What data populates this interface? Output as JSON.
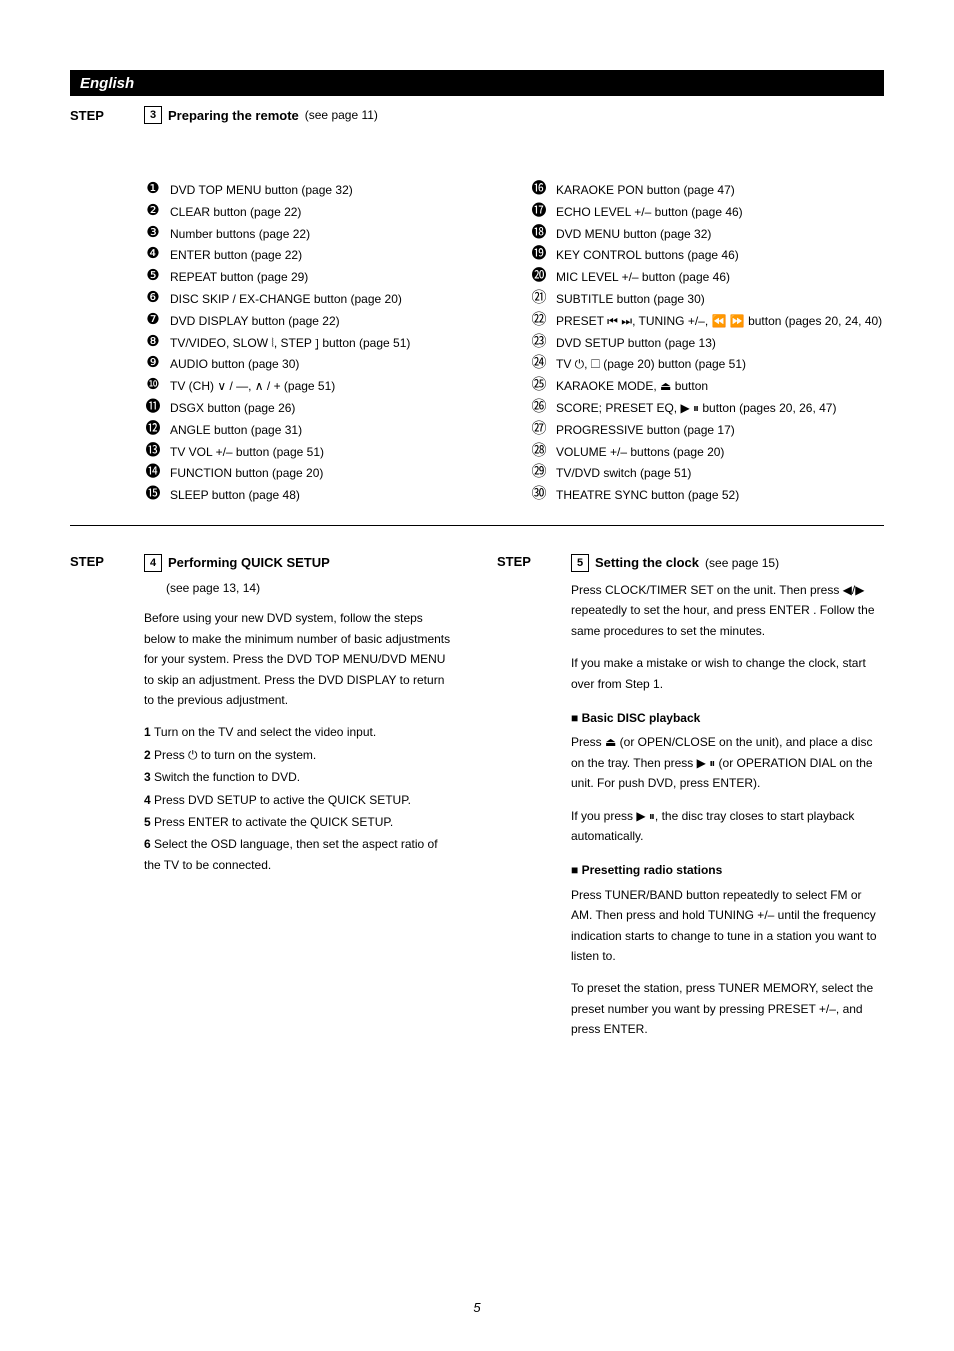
{
  "header_bar": "English",
  "step3": {
    "label": "STEP",
    "number": "3",
    "title": "Preparing the remote",
    "note": "(see page 11)",
    "columns": {
      "left": [
        {
          "num": "❶",
          "text": "DVD TOP MENU button (page 32)"
        },
        {
          "num": "❷",
          "text": "CLEAR button (page 22)"
        },
        {
          "num": "❸",
          "text": "Number buttons (page 22)"
        },
        {
          "num": "❹",
          "text": "ENTER button (page 22)"
        },
        {
          "num": "❺",
          "text": "REPEAT button (page 29)"
        },
        {
          "num": "❻",
          "text": "DISC SKIP / EX-CHANGE button (page 20)"
        },
        {
          "num": "❼",
          "text": "DVD DISPLAY button (page 22)"
        },
        {
          "num": "❽",
          "text": "TV/VIDEO, SLOW ⦚, STEP ⦌ button (page 51)"
        },
        {
          "num": "❾",
          "text": "AUDIO button (page 30)"
        },
        {
          "num": "❿",
          "text": "TV (CH) ∨ / —, ∧ / + (page 51)"
        },
        {
          "num": "⓫",
          "text": "DSGX button (page 26)"
        },
        {
          "num": "⓬",
          "text": "ANGLE button (page 31)"
        },
        {
          "num": "⓭",
          "text": "TV VOL +/– button (page 51)"
        },
        {
          "num": "⓮",
          "text": "FUNCTION button (page 20)"
        },
        {
          "num": "⓯",
          "text": "SLEEP button (page 48)"
        }
      ],
      "right": [
        {
          "num": "⓰",
          "text": "KARAOKE PON button (page 47)"
        },
        {
          "num": "⓱",
          "text": "ECHO LEVEL +/– button (page 46)"
        },
        {
          "num": "⓲",
          "text": "DVD MENU button (page 32)"
        },
        {
          "num": "⓳",
          "text": "KEY CONTROL buttons (page 46)"
        },
        {
          "num": "⓴",
          "text": "MIC LEVEL +/– button (page 46)"
        },
        {
          "num": "㉑",
          "text": "SUBTITLE button (page 30)"
        },
        {
          "num": "㉒",
          "text": "PRESET ⏮ ⏭, TUNING +/–, ⏪ ⏩ button (pages 20, 24, 40)"
        },
        {
          "num": "㉓",
          "text": "DVD SETUP button (page 13)"
        },
        {
          "num": "㉔",
          "text": "TV ⏻, ☐ (page 20) button (page 51)"
        },
        {
          "num": "㉕",
          "text": "KARAOKE MODE, ⏏ button"
        },
        {
          "num": "㉖",
          "text": "SCORE; PRESET EQ, ▶ ⏸ button (pages 20, 26, 47)"
        },
        {
          "num": "㉗",
          "text": "PROGRESSIVE button (page 17)"
        },
        {
          "num": "㉘",
          "text": "VOLUME +/– buttons (page 20)"
        },
        {
          "num": "㉙",
          "text": "TV/DVD switch (page 51)"
        },
        {
          "num": "㉚",
          "text": "THEATRE SYNC button (page 52)"
        }
      ]
    }
  },
  "step4": {
    "label": "STEP",
    "number": "4",
    "title": "Performing QUICK SETUP",
    "note": "(see page 13, 14)",
    "intro": "Before using your new DVD system, follow the steps below to make the minimum number of basic adjustments for your system. Press the DVD TOP MENU/DVD MENU to skip an adjustment. Press the DVD DISPLAY to return to the previous adjustment.",
    "items": [
      {
        "n": "1",
        "text": "Turn on the TV and select the video input."
      },
      {
        "n": "2",
        "text": "Press ⏻ to turn on the system."
      },
      {
        "n": "3",
        "text": "Switch the function to DVD."
      },
      {
        "n": "4",
        "text": "Press DVD SETUP to active the QUICK SETUP."
      },
      {
        "n": "5",
        "text": "Press ENTER to activate the QUICK SETUP."
      },
      {
        "n": "6",
        "text": "Select the OSD language, then set the aspect ratio of the TV to be connected."
      }
    ]
  },
  "step5": {
    "label": "STEP",
    "number": "5",
    "title": "Setting the clock",
    "note": "(see page 15)",
    "paragraphs": [
      "Press CLOCK/TIMER SET on the unit. Then press ◀/▶ repeatedly to set the hour, and press ENTER . Follow the same procedures to set the minutes.",
      "If you make a mistake or wish to change the clock, start over from Step 1."
    ],
    "playback_heading": "■ Basic DISC playback",
    "playback_text": [
      "Press ⏏ (or OPEN/CLOSE on the unit), and place a disc on the tray. Then press ▶ ⏸ (or OPERATION DIAL on the unit. For push DVD, press ENTER).",
      "If you press ▶ ⏸, the disc tray closes to start playback automatically."
    ],
    "radio_heading": "■ Presetting radio stations",
    "radio_text": [
      "Press TUNER/BAND button repeatedly to select FM or AM. Then press and hold TUNING +/– until the frequency indication starts to change to tune in a station you want to listen to.",
      "To preset the station, press TUNER MEMORY, select the preset number you want by pressing PRESET +/–, and press ENTER."
    ]
  },
  "page_number": "5"
}
